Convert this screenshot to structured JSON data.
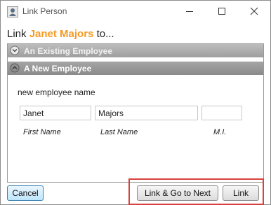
{
  "window": {
    "title": "Link Person"
  },
  "heading": {
    "prefix": "Link",
    "person_name": "Janet Majors",
    "suffix": "to..."
  },
  "accordion": {
    "sections": [
      {
        "label": "An Existing Employee",
        "expanded": false
      },
      {
        "label": "A New Employee",
        "expanded": true
      }
    ]
  },
  "new_employee": {
    "section_label": "new employee name",
    "first_name": {
      "value": "Janet",
      "label": "First Name"
    },
    "last_name": {
      "value": "Majors",
      "label": "Last Name"
    },
    "middle_initial": {
      "value": "",
      "label": "M.I."
    }
  },
  "buttons": {
    "cancel": "Cancel",
    "link_and_next": "Link & Go to Next",
    "link": "Link"
  },
  "colors": {
    "person_name": "#f59a23",
    "highlight_border": "#d9423c",
    "accordion_header": "#8a8a8a"
  },
  "icons": [
    "person-link-icon",
    "minimize-icon",
    "maximize-icon",
    "close-icon",
    "chevron-down-icon",
    "chevron-up-icon"
  ]
}
